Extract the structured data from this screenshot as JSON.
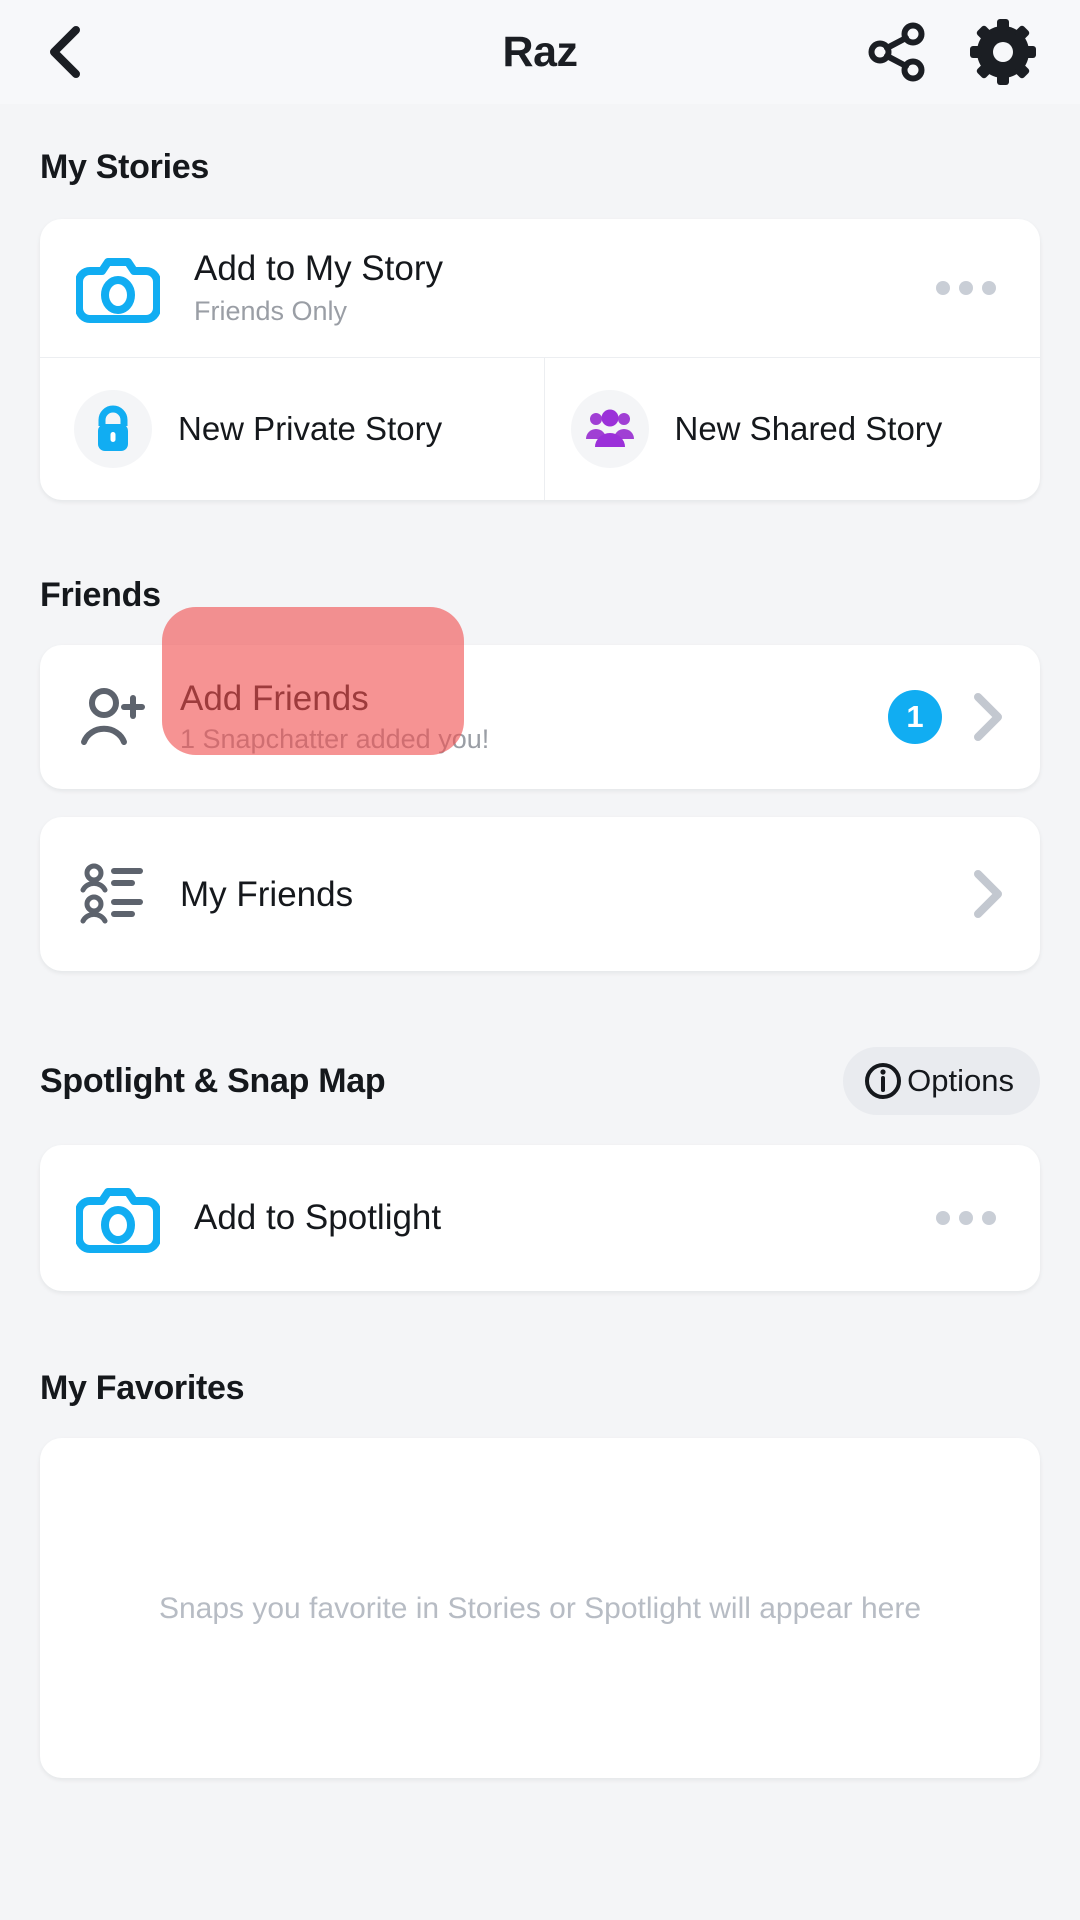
{
  "header": {
    "title": "Raz",
    "back_icon": "chevron-left-icon",
    "share_icon": "share-icon",
    "settings_icon": "gear-icon"
  },
  "my_stories": {
    "section_title": "My Stories",
    "add_to_my_story": {
      "title": "Add to My Story",
      "subtitle": "Friends Only",
      "icon": "camera-icon",
      "more_icon": "more-horizontal-icon"
    },
    "new_private_story": {
      "label": "New Private Story",
      "icon": "lock-icon",
      "icon_color": "#11adf2"
    },
    "new_shared_story": {
      "label": "New Shared Story",
      "icon": "group-icon",
      "icon_color": "#a03fd4"
    }
  },
  "friends": {
    "section_title": "Friends",
    "add_friends": {
      "title": "Add Friends",
      "subtitle": "1 Snapchatter added you!",
      "icon": "person-add-icon",
      "badge": "1",
      "badge_color": "#11adf2",
      "chevron_icon": "chevron-right-icon",
      "highlight_color": "#f05050"
    },
    "my_friends": {
      "label": "My Friends",
      "icon": "friends-list-icon",
      "chevron_icon": "chevron-right-icon"
    }
  },
  "spotlight": {
    "section_title": "Spotlight & Snap Map",
    "options_label": "Options",
    "options_icon": "info-icon",
    "add_to_spotlight": {
      "label": "Add to Spotlight",
      "icon": "camera-icon",
      "more_icon": "more-horizontal-icon"
    }
  },
  "favorites": {
    "section_title": "My Favorites",
    "empty_text": "Snaps you favorite in Stories or Spotlight will appear here"
  }
}
